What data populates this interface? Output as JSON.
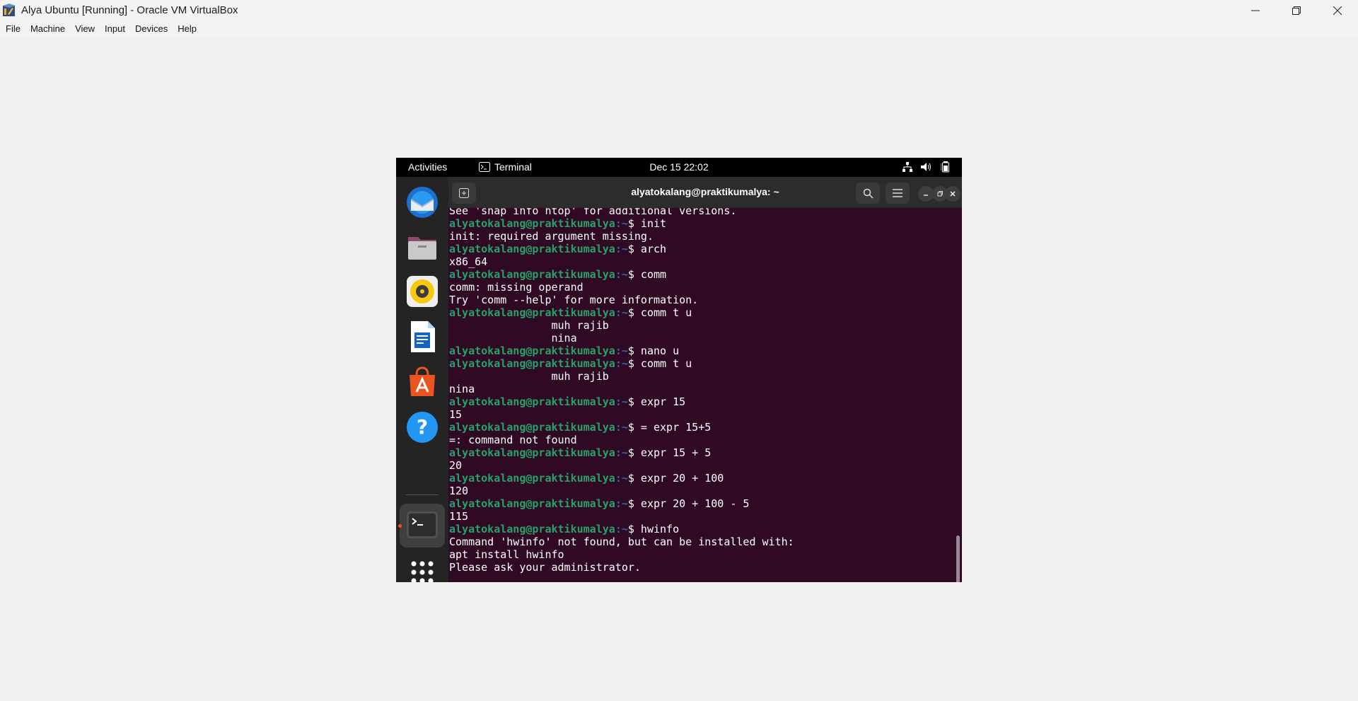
{
  "window": {
    "title": "Alya Ubuntu [Running] - Oracle VM VirtualBox",
    "controls": [
      "minimize-icon",
      "restore-icon",
      "close-icon"
    ]
  },
  "menubar": [
    "File",
    "Machine",
    "View",
    "Input",
    "Devices",
    "Help"
  ],
  "guest": {
    "topbar": {
      "activities": "Activities",
      "app": "Terminal",
      "clock": "Dec 15  22:02",
      "tray": [
        "network-icon",
        "volume-icon",
        "battery-icon"
      ]
    },
    "dock": [
      "thunderbird-icon",
      "files-icon",
      "rhythmbox-icon",
      "writer-icon",
      "app-center-icon",
      "help-icon",
      "terminal-icon",
      "show-apps-icon"
    ],
    "terminal": {
      "title": "alyatokalang@praktikumalya: ~",
      "prompt_user": "alyatokalang@praktikumalya",
      "prompt_path": ":~",
      "lines": [
        {
          "type": "out",
          "text": "See 'snap info htop' for additional versions."
        },
        {
          "type": "cmd",
          "text": "init"
        },
        {
          "type": "out",
          "text": "init: required argument missing."
        },
        {
          "type": "cmd",
          "text": "arch"
        },
        {
          "type": "out",
          "text": "x86_64"
        },
        {
          "type": "cmd",
          "text": "comm"
        },
        {
          "type": "out",
          "text": "comm: missing operand"
        },
        {
          "type": "out",
          "text": "Try 'comm --help' for more information."
        },
        {
          "type": "cmd",
          "text": "comm t u"
        },
        {
          "type": "out",
          "text": "                muh rajib"
        },
        {
          "type": "out",
          "text": "                nina"
        },
        {
          "type": "cmd",
          "text": "nano u"
        },
        {
          "type": "cmd",
          "text": "comm t u"
        },
        {
          "type": "out",
          "text": "                muh rajib"
        },
        {
          "type": "out",
          "text": "nina"
        },
        {
          "type": "cmd",
          "text": "expr 15"
        },
        {
          "type": "out",
          "text": "15"
        },
        {
          "type": "cmd",
          "text": "= expr 15+5"
        },
        {
          "type": "out",
          "text": "=: command not found"
        },
        {
          "type": "cmd",
          "text": "expr 15 + 5"
        },
        {
          "type": "out",
          "text": "20"
        },
        {
          "type": "cmd",
          "text": "expr 20 + 100"
        },
        {
          "type": "out",
          "text": "120"
        },
        {
          "type": "cmd",
          "text": "expr 20 + 100 - 5"
        },
        {
          "type": "out",
          "text": "115"
        },
        {
          "type": "cmd",
          "text": "hwinfo"
        },
        {
          "type": "out",
          "text": "Command 'hwinfo' not found, but can be installed with:"
        },
        {
          "type": "out",
          "text": "apt install hwinfo"
        },
        {
          "type": "out",
          "text": "Please ask your administrator."
        }
      ]
    }
  }
}
